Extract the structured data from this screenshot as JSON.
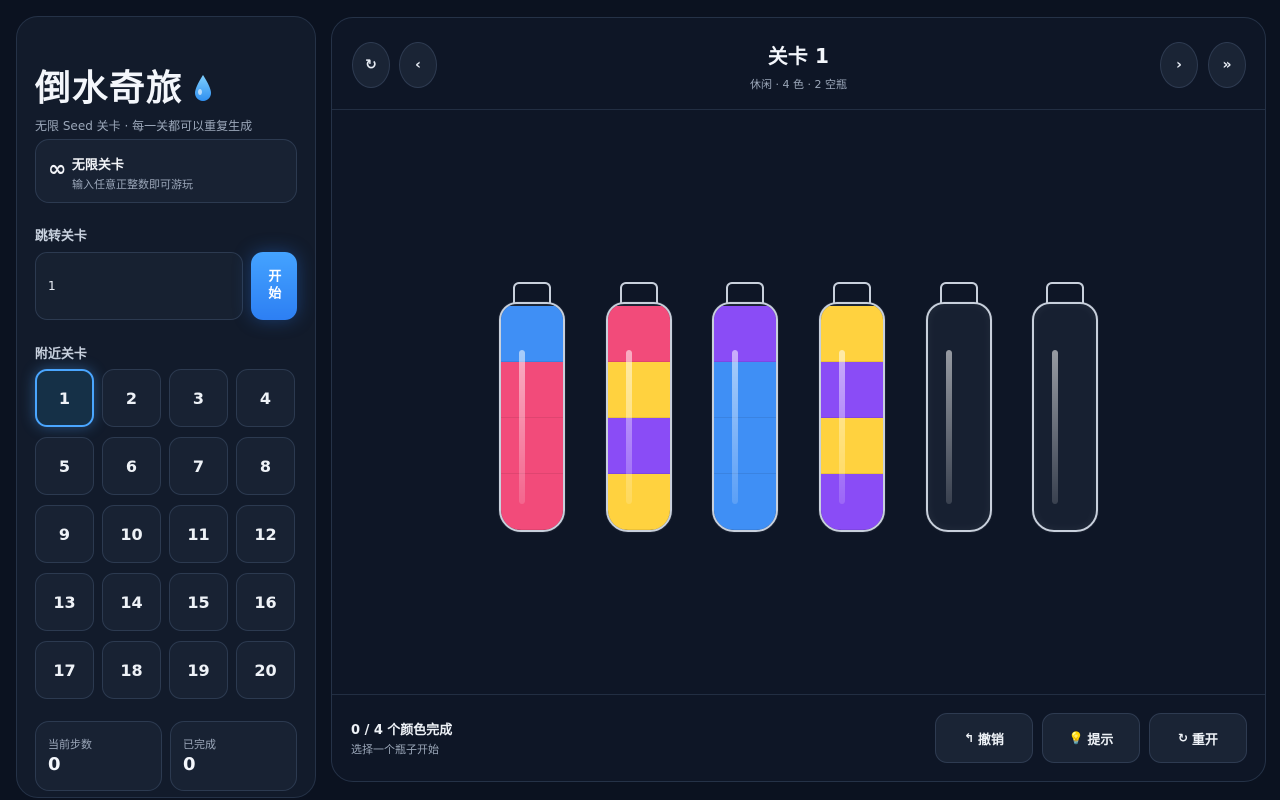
{
  "sidebar": {
    "title": "倒水奇旅",
    "subtitle": "无限 Seed 关卡 · 每一关都可以重复生成",
    "infinite": {
      "icon": "∞",
      "title": "无限关卡",
      "desc": "输入任意正整数即可游玩"
    },
    "jump_label": "跳转关卡",
    "jump_value": "1",
    "start_label": "开始",
    "nearby_label": "附近关卡",
    "levels": [
      "1",
      "2",
      "3",
      "4",
      "5",
      "6",
      "7",
      "8",
      "9",
      "10",
      "11",
      "12",
      "13",
      "14",
      "15",
      "16",
      "17",
      "18",
      "19",
      "20"
    ],
    "active_level": "1",
    "stats": [
      {
        "label": "当前步数",
        "value": "0"
      },
      {
        "label": "已完成",
        "value": "0"
      }
    ]
  },
  "header": {
    "title": "关卡 1",
    "meta": "休闲 · 4 色 · 2 空瓶",
    "restart_icon": "↻",
    "prev_icon": "‹",
    "next_icon": "›",
    "skip_icon": "»"
  },
  "colors": {
    "blue": "#3f8ff5",
    "pink": "#f24b7a",
    "yellow": "#ffd23f",
    "purple": "#8a4cf6"
  },
  "bottles": [
    [
      "pink",
      "pink",
      "pink",
      "blue"
    ],
    [
      "yellow",
      "purple",
      "yellow",
      "pink"
    ],
    [
      "blue",
      "blue",
      "blue",
      "purple"
    ],
    [
      "purple",
      "yellow",
      "purple",
      "yellow"
    ],
    [],
    []
  ],
  "footer": {
    "progress": "0 / 4 个颜色完成",
    "hint": "选择一个瓶子开始",
    "undo_label": "撤销",
    "hint_label": "提示",
    "restart_label": "重开",
    "undo_icon": "↰",
    "hint_icon": "💡",
    "restart_icon": "↻"
  }
}
